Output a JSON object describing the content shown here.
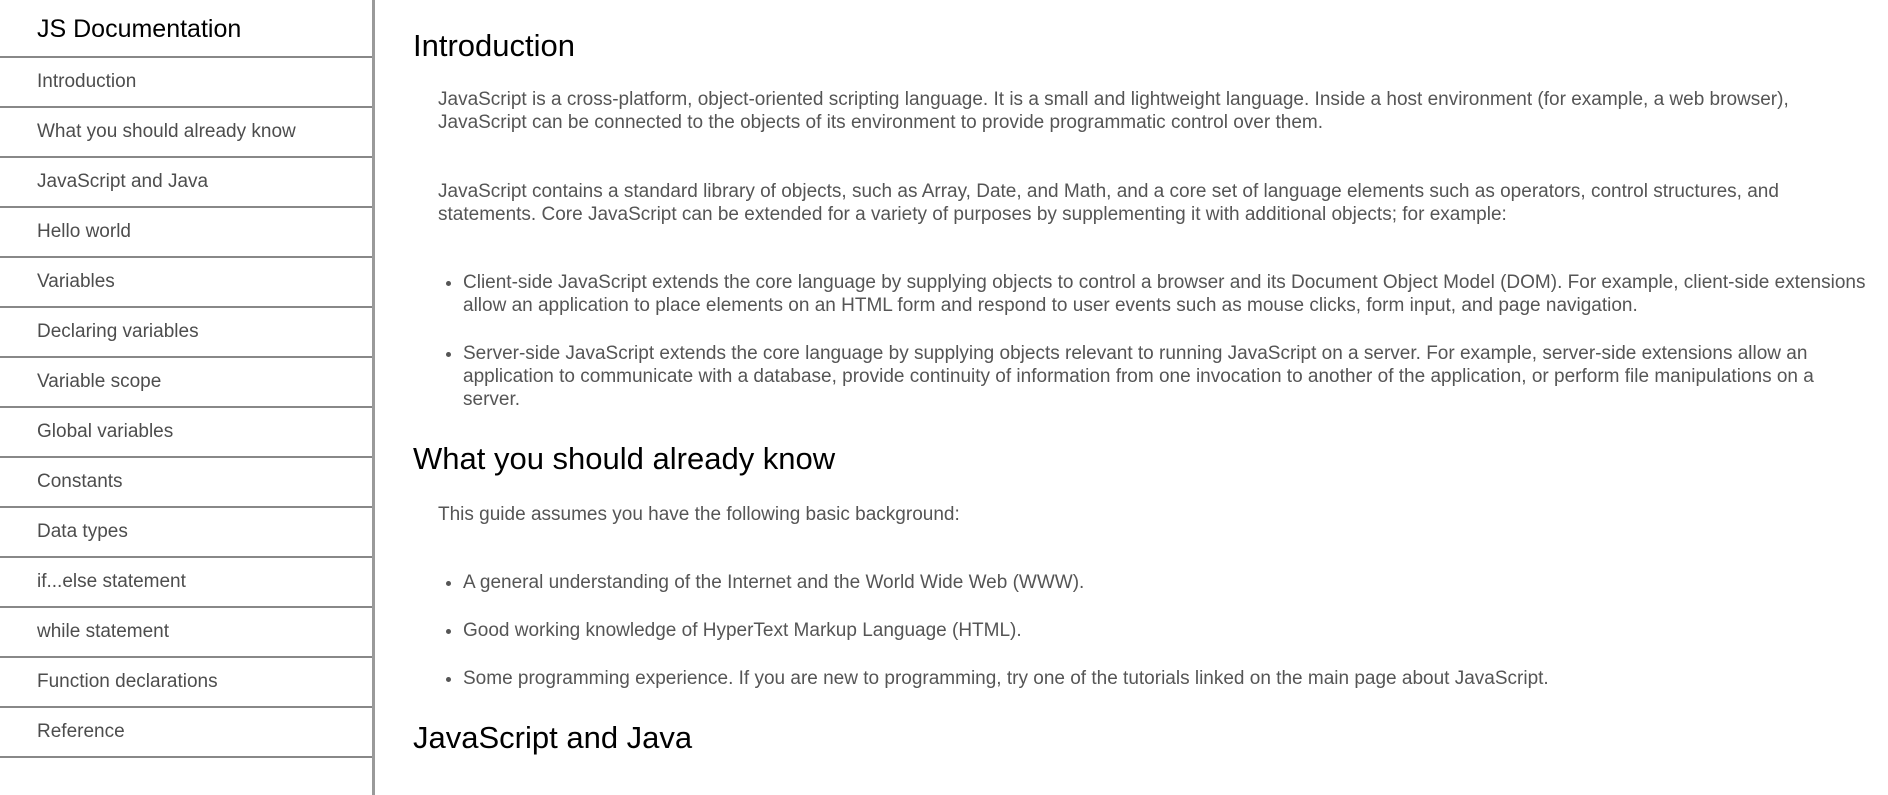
{
  "navbar": {
    "title": "JS Documentation",
    "items": [
      "Introduction",
      "What you should already know",
      "JavaScript and Java",
      "Hello world",
      "Variables",
      "Declaring variables",
      "Variable scope",
      "Global variables",
      "Constants",
      "Data types",
      "if...else statement",
      "while statement",
      "Function declarations",
      "Reference"
    ]
  },
  "main": {
    "intro": {
      "heading": "Introduction",
      "p1": "JavaScript is a cross-platform, object-oriented scripting language. It is a small and lightweight language. Inside a host environment (for example, a web browser), JavaScript can be connected to the objects of its environment to provide programmatic control over them.",
      "p2": "JavaScript contains a standard library of objects, such as Array, Date, and Math, and a core set of language elements such as operators, control structures, and statements. Core JavaScript can be extended for a variety of purposes by supplementing it with additional objects; for example:",
      "bullets": [
        "Client-side JavaScript extends the core language by supplying objects to control a browser and its Document Object Model (DOM). For example, client-side extensions allow an application to place elements on an HTML form and respond to user events such as mouse clicks, form input, and page navigation.",
        "Server-side JavaScript extends the core language by supplying objects relevant to running JavaScript on a server. For example, server-side extensions allow an application to communicate with a database, provide continuity of information from one invocation to another of the application, or perform file manipulations on a server."
      ]
    },
    "know": {
      "heading": "What you should already know",
      "p1": "This guide assumes you have the following basic background:",
      "bullets": [
        "A general understanding of the Internet and the World Wide Web (WWW).",
        "Good working knowledge of HyperText Markup Language (HTML).",
        "Some programming experience. If you are new to programming, try one of the tutorials linked on the main page about JavaScript."
      ]
    },
    "java": {
      "heading": "JavaScript and Java"
    }
  }
}
